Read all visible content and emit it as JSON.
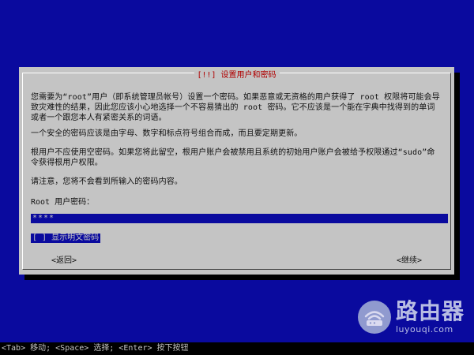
{
  "dialog": {
    "title": "[!!] 设置用户和密码",
    "paragraph1": "您需要为“root”用户（即系统管理员帐号）设置一个密码。如果恶意或无资格的用户获得了 root 权限将可能会导致灾难性的结果，因此您应该小心地选择一个不容易猜出的 root 密码。它不应该是一个能在字典中找得到的单词或者一个跟您本人有紧密关系的词语。",
    "paragraph2": "一个安全的密码应该是由字母、数字和标点符号组合而成，而且要定期更新。",
    "paragraph3": "根用户不应使用空密码。如果您将此留空，根用户账户会被禁用且系统的初始用户账户会被给予权限通过“sudo”命令获得根用户权限。",
    "paragraph4": "请注意，您将不会看到所输入的密码内容。",
    "password_prompt": "Root 用户密码：",
    "password_value": "****",
    "show_password_label": "[ ] 显示明文密码",
    "back_label": "<返回>",
    "continue_label": "<继续>"
  },
  "statusbar": {
    "text": "<Tab> 移动; <Space> 选择; <Enter> 按下按钮"
  },
  "watermark": {
    "name": "路由器",
    "url": "luyouqi.com",
    "icon": "router-wifi-icon"
  },
  "colors": {
    "background": "#0a0a9e",
    "dialog": "#c4c4c4",
    "title": "#b00000",
    "statusbar": "#000000"
  }
}
